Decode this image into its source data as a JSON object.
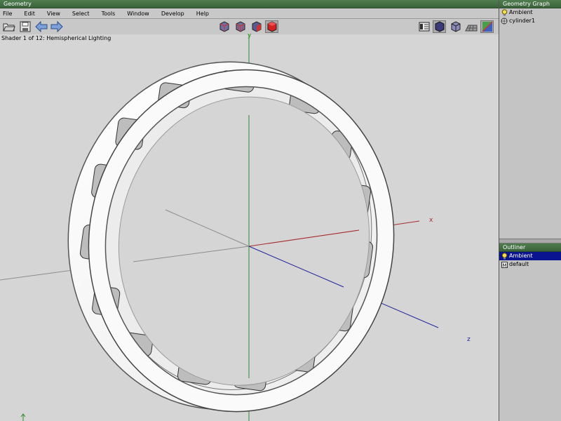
{
  "window": {
    "title": "Geometry"
  },
  "menu": [
    "File",
    "Edit",
    "View",
    "Select",
    "Tools",
    "Window",
    "Develop",
    "Help"
  ],
  "toolbar": {
    "left": [
      "folder-open-icon",
      "save-icon",
      "back-arrow-icon",
      "forward-arrow-icon"
    ],
    "center": [
      "cube-view-1-icon",
      "cube-view-2-icon",
      "cube-view-3-icon",
      "cube-solid-red-icon"
    ],
    "right": [
      "layout-icon",
      "shaded-sphere-icon",
      "wire-cube-icon",
      "grid-floor-icon",
      "color-ramp-icon"
    ]
  },
  "viewport": {
    "shader_label": "Shader 1 of 12: Hemispherical Lighting",
    "axes": {
      "x": "x",
      "y": "y",
      "z": "z"
    },
    "colors": {
      "x_axis": "#a52a2a",
      "y_axis": "#2e8b2e",
      "z_axis": "#2323a0"
    }
  },
  "geometry_graph": {
    "title": "Geometry Graph",
    "items": [
      {
        "label": "Ambient",
        "icon": "light-bulb-icon"
      },
      {
        "label": "cylinder1",
        "icon": "mesh-icon"
      }
    ]
  },
  "outliner": {
    "title": "Outliner",
    "items": [
      {
        "label": "Ambient",
        "icon": "light-bulb-icon",
        "selected": true
      },
      {
        "label": "default",
        "icon": "material-icon",
        "selected": false
      }
    ]
  }
}
